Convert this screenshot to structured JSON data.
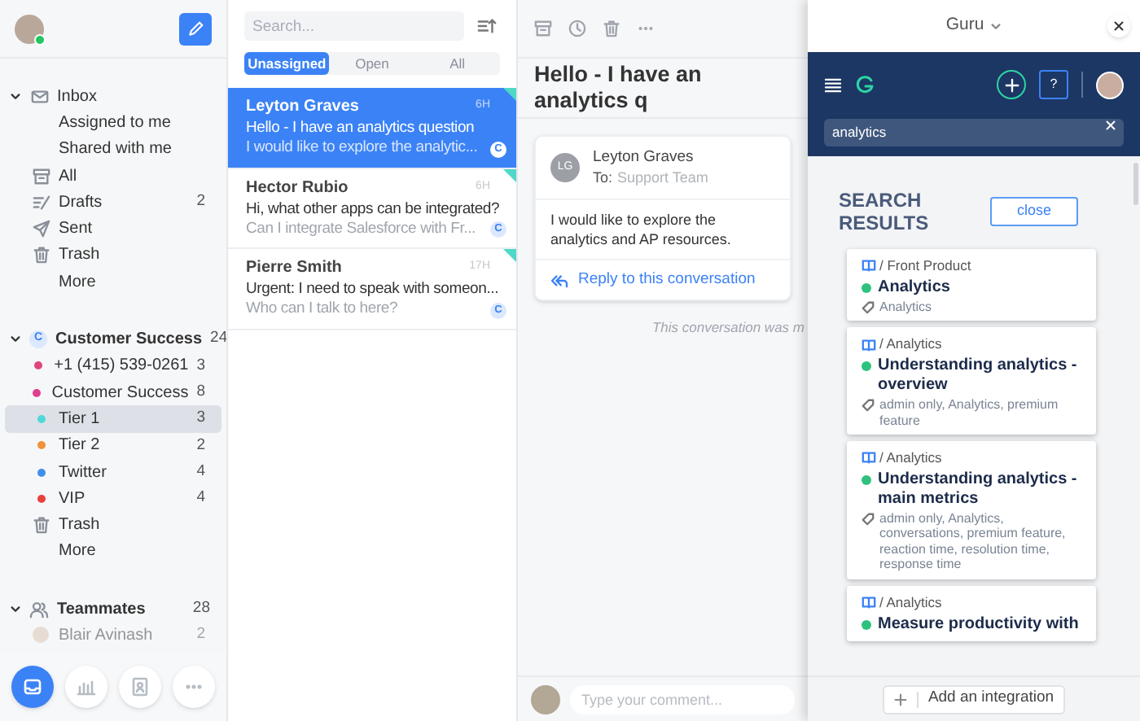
{
  "sidebar": {
    "user": {
      "online": true
    },
    "sections": [
      {
        "label": "Inbox",
        "expanded": true,
        "items": [
          {
            "label": "Assigned to me",
            "selected": false
          },
          {
            "label": "Shared with me",
            "selected": false
          },
          {
            "label": "All",
            "selected": false
          },
          {
            "label": "Drafts",
            "count": "2",
            "selected": false
          },
          {
            "label": "Sent",
            "selected": false
          },
          {
            "label": "Trash",
            "selected": false
          },
          {
            "label": "More",
            "selected": false
          }
        ]
      },
      {
        "label": "Customer Success",
        "badge": "C",
        "count": "24",
        "expanded": true,
        "items": [
          {
            "label": "+1 (415) 539-0261",
            "count": "3",
            "color": "#e0457b",
            "selected": false
          },
          {
            "label": "Customer Success",
            "count": "8",
            "color": "#e23d8f",
            "selected": false
          },
          {
            "label": "Tier 1",
            "count": "3",
            "color": "#4fd8d8",
            "selected": true
          },
          {
            "label": "Tier 2",
            "count": "2",
            "color": "#f0933b",
            "selected": false
          },
          {
            "label": "Twitter",
            "count": "4",
            "color": "#3f8fe8",
            "selected": false
          },
          {
            "label": "VIP",
            "count": "4",
            "color": "#e8403f",
            "selected": false
          },
          {
            "label": "Trash",
            "selected": false
          },
          {
            "label": "More",
            "selected": false
          }
        ]
      },
      {
        "label": "Teammates",
        "count": "28",
        "expanded": true,
        "items": [
          {
            "label": "Blair Avinash",
            "count": "2",
            "selected": false
          }
        ]
      }
    ],
    "bottom_nav": [
      {
        "selected": true
      },
      {
        "selected": false
      },
      {
        "selected": false
      },
      {
        "selected": false
      }
    ]
  },
  "conversation_list": {
    "search": {
      "placeholder": "Search..."
    },
    "filters": [
      {
        "label": "Unassigned",
        "selected": true
      },
      {
        "label": "Open",
        "selected": false
      },
      {
        "label": "All",
        "selected": false
      }
    ],
    "conversations": [
      {
        "name": "Leyton Graves",
        "time": "6H",
        "subject": "Hello - I have an analytics question",
        "preview": "I would like to explore the analytic...",
        "badge": "C",
        "selected": true
      },
      {
        "name": "Hector Rubio",
        "time": "6H",
        "subject": "Hi, what other apps can be integrated?",
        "preview": "Can I integrate Salesforce with Fr...",
        "badge": "C",
        "selected": false
      },
      {
        "name": "Pierre Smith",
        "time": "17H",
        "subject": "Urgent: I need to speak with someon...",
        "preview": "Who can I talk to here?",
        "badge": "C",
        "selected": false
      }
    ]
  },
  "conversation": {
    "title": "Hello - I have an analytics q",
    "message": {
      "initials": "LG",
      "sender": "Leyton Graves",
      "to_label": "To:",
      "to": "Support Team",
      "body": "I would like to explore the analytics and AP resources.",
      "reply_link": "Reply to this conversation"
    },
    "note": "This conversation was m",
    "comment": {
      "placeholder": "Type your comment..."
    }
  },
  "guru": {
    "title": "Guru",
    "search": {
      "value": "analytics"
    },
    "help_button": "?",
    "results": {
      "heading": "SEARCH RESULTS",
      "close_button": "close",
      "cards": [
        {
          "collection": "/ Front Product",
          "title": "Analytics",
          "tags": "Analytics"
        },
        {
          "collection": "/ Analytics",
          "title": "Understanding analytics - overview",
          "tags": "admin only, Analytics, premium feature"
        },
        {
          "collection": "/ Analytics",
          "title": "Understanding analytics - main metrics",
          "tags": "admin only, Analytics, conversations, premium feature, reaction time, resolution time, response time"
        },
        {
          "collection": "/ Analytics",
          "title": "Measure productivity with"
        }
      ]
    },
    "footer": {
      "button": "Add an integration"
    }
  }
}
